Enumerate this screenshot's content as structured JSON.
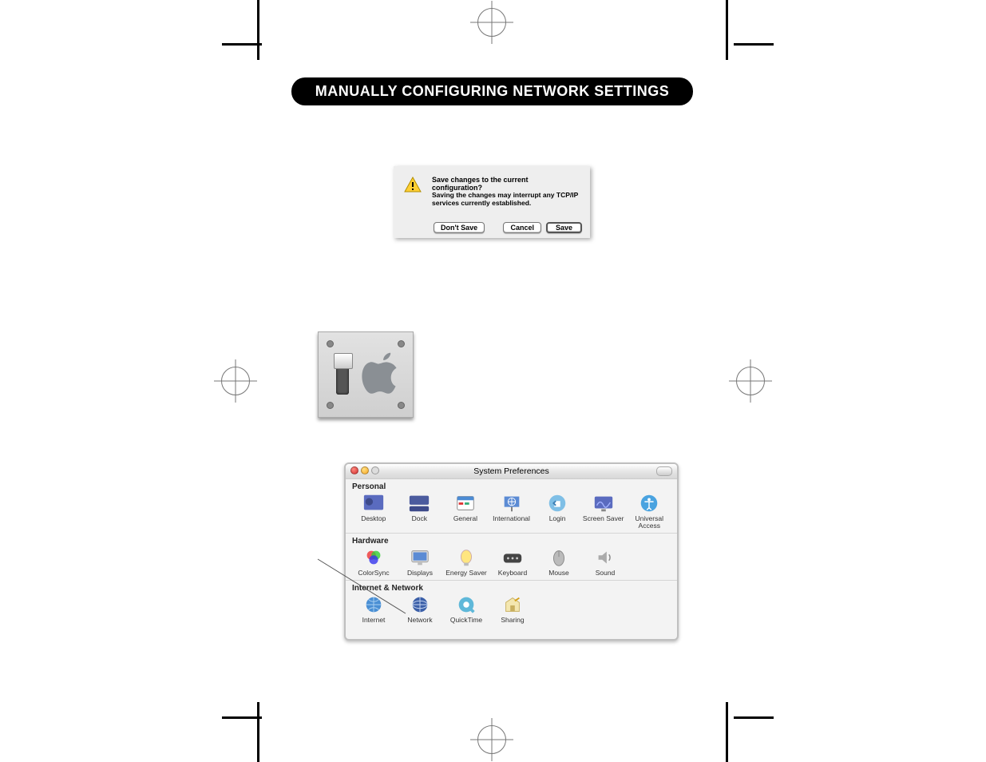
{
  "header": {
    "title": "MANUALLY CONFIGURING NETWORK SETTINGS"
  },
  "save_dialog": {
    "title": "Save changes to the current configuration?",
    "body": "Saving the changes may interrupt any TCP/IP services currently established.",
    "dont_save": "Don't Save",
    "cancel": "Cancel",
    "save": "Save"
  },
  "sysprefs_window": {
    "title": "System Preferences",
    "sections": {
      "personal": {
        "label": "Personal",
        "items": [
          {
            "label": "Desktop"
          },
          {
            "label": "Dock"
          },
          {
            "label": "General"
          },
          {
            "label": "International"
          },
          {
            "label": "Login"
          },
          {
            "label": "Screen Saver"
          },
          {
            "label": "Universal Access"
          }
        ]
      },
      "hardware": {
        "label": "Hardware",
        "items": [
          {
            "label": "ColorSync"
          },
          {
            "label": "Displays"
          },
          {
            "label": "Energy Saver"
          },
          {
            "label": "Keyboard"
          },
          {
            "label": "Mouse"
          },
          {
            "label": "Sound"
          }
        ]
      },
      "internet_network": {
        "label": "Internet & Network",
        "items": [
          {
            "label": "Internet"
          },
          {
            "label": "Network"
          },
          {
            "label": "QuickTime"
          },
          {
            "label": "Sharing"
          }
        ]
      }
    }
  }
}
